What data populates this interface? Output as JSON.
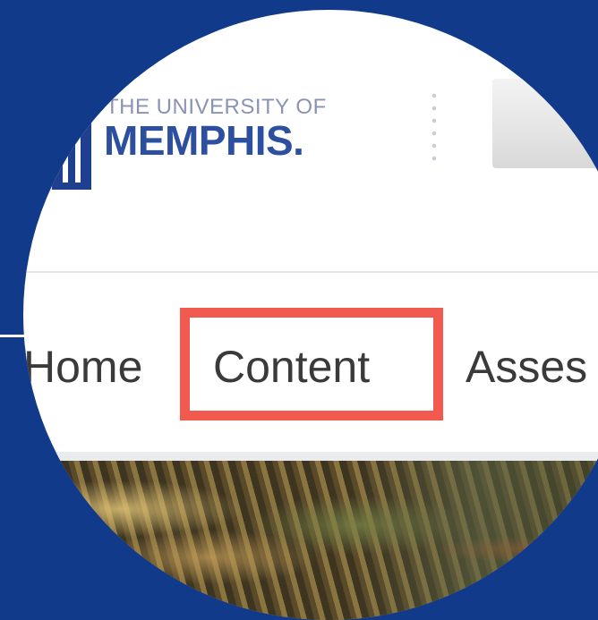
{
  "header": {
    "logo_small": "THE UNIVERSITY OF",
    "logo_big": "MEMPHIS."
  },
  "nav": {
    "items": [
      {
        "label": "Home"
      },
      {
        "label": "Content"
      },
      {
        "label": "Asses"
      }
    ],
    "highlighted_index": 1
  },
  "colors": {
    "background": "#113a8a",
    "highlight": "#f25a50",
    "logo_blue": "#2d4fa0"
  },
  "icons": {
    "logo": "university-of-memphis-logo"
  }
}
